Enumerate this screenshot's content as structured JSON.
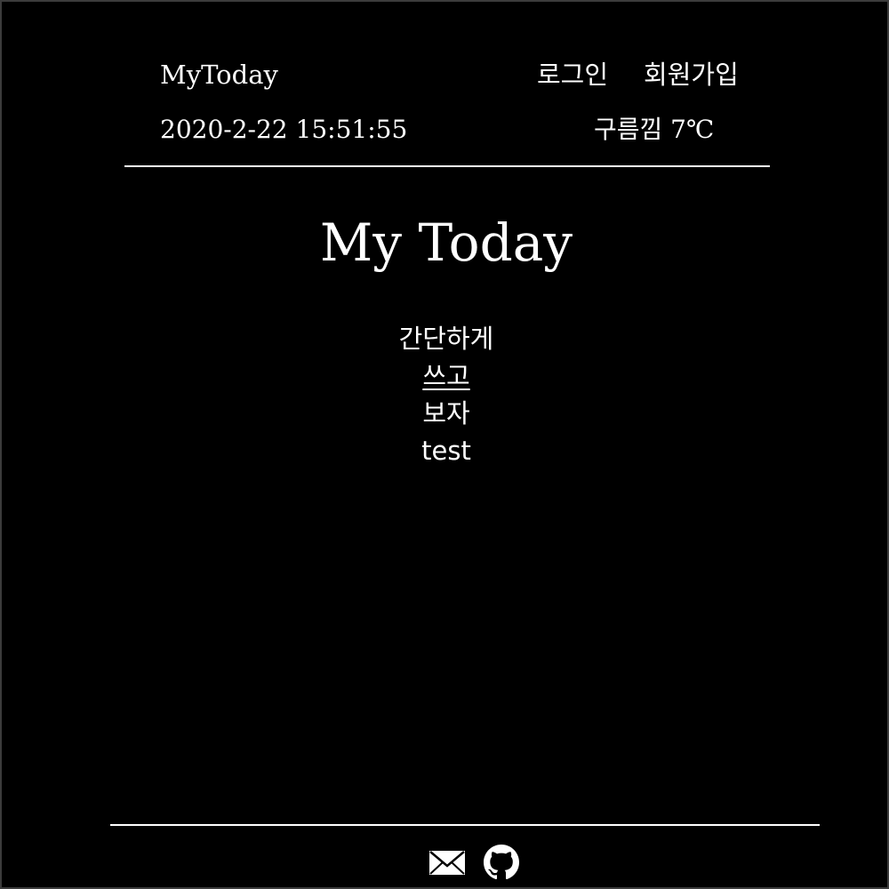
{
  "header": {
    "brand": "MyToday",
    "login": "로그인",
    "signup": "회원가입",
    "datetime": "2020-2-22 15:51:55",
    "weather": "구름낌 7℃"
  },
  "hero": {
    "title": "My Today",
    "lines": [
      "간단하게",
      "쓰고",
      "보자",
      "test"
    ]
  },
  "footer": {
    "icons": [
      "mail-icon",
      "github-icon"
    ]
  },
  "colors": {
    "background": "#000000",
    "text": "#ffffff",
    "frame": "#3c3c3c"
  }
}
